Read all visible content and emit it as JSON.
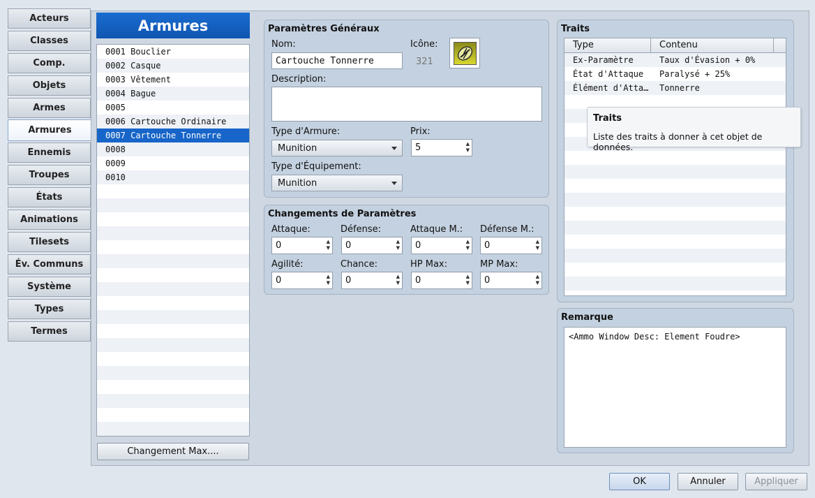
{
  "sidebar": {
    "tabs": [
      "Acteurs",
      "Classes",
      "Comp.",
      "Objets",
      "Armes",
      "Armures",
      "Ennemis",
      "Troupes",
      "États",
      "Animations",
      "Tilesets",
      "Év. Communs",
      "Système",
      "Types",
      "Termes"
    ],
    "active_index": 5
  },
  "list": {
    "title": "Armures",
    "items": [
      "0001 Bouclier",
      "0002 Casque",
      "0003 Vêtement",
      "0004 Bague",
      "0005",
      "0006 Cartouche Ordinaire",
      "0007 Cartouche Tonnerre",
      "0008",
      "0009",
      "0010"
    ],
    "selected_index": 6,
    "max_button": "Changement Max...."
  },
  "general": {
    "title": "Paramètres Généraux",
    "name_label": "Nom:",
    "name_value": "Cartouche Tonnerre",
    "icon_label": "Icône:",
    "icon_index": "321",
    "description_label": "Description:",
    "description_value": "",
    "armor_type_label": "Type d'Armure:",
    "armor_type_value": "Munition",
    "price_label": "Prix:",
    "price_value": "5",
    "equip_type_label": "Type d'Équipement:",
    "equip_type_value": "Munition"
  },
  "params": {
    "title": "Changements de Paramètres",
    "fields": [
      {
        "label": "Attaque:",
        "value": "0"
      },
      {
        "label": "Défense:",
        "value": "0"
      },
      {
        "label": "Attaque M.:",
        "value": "0"
      },
      {
        "label": "Défense M.:",
        "value": "0"
      },
      {
        "label": "Agilité:",
        "value": "0"
      },
      {
        "label": "Chance:",
        "value": "0"
      },
      {
        "label": "HP Max:",
        "value": "0"
      },
      {
        "label": "MP Max:",
        "value": "0"
      }
    ]
  },
  "traits": {
    "title": "Traits",
    "col_type": "Type",
    "col_content": "Contenu",
    "rows": [
      {
        "type": "Ex-Paramètre",
        "content": "Taux d'Évasion + 0%"
      },
      {
        "type": "État d'Attaque",
        "content": "Paralysé + 25%"
      },
      {
        "type": "Élément d'Atta…",
        "content": "Tonnerre"
      }
    ],
    "tooltip_title": "Traits",
    "tooltip_text": "Liste des traits à donner à cet objet de données."
  },
  "note": {
    "title": "Remarque",
    "value": "<Ammo Window Desc: Element Foudre>"
  },
  "footer": {
    "ok": "OK",
    "cancel": "Annuler",
    "apply": "Appliquer"
  },
  "colors": {
    "accent": "#1765c8",
    "panel": "#c4d1e0"
  }
}
